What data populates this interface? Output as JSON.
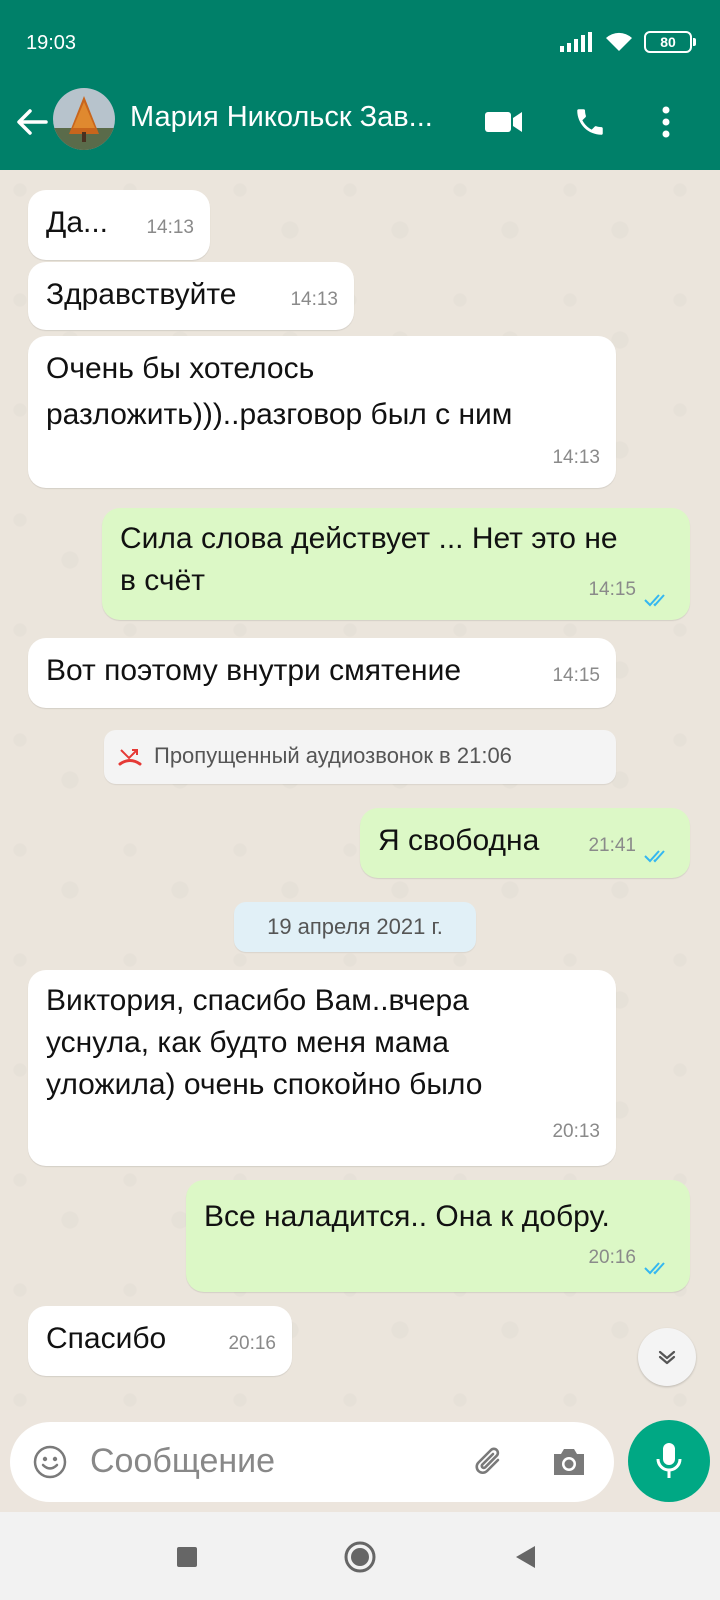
{
  "status_bar": {
    "time": "19:03",
    "battery": "80"
  },
  "header": {
    "contact_name": "Мария  Никольск Зав..."
  },
  "messages": [
    {
      "dir": "in",
      "text": "Да...",
      "time": "14:13"
    },
    {
      "dir": "in",
      "text": "Здравствуйте",
      "time": "14:13"
    },
    {
      "dir": "in",
      "lines": [
        "Очень бы хотелось",
        "разложить)))..разговор был с ним"
      ],
      "time": "14:13"
    },
    {
      "dir": "out",
      "lines": [
        "Сила слова действует ... Нет это не",
        "в счёт"
      ],
      "time": "14:15",
      "status": "read"
    },
    {
      "dir": "in",
      "text": "Вот поэтому внутри смятение",
      "time": "14:15"
    },
    {
      "dir": "system",
      "text": "Пропущенный аудиозвонок в 21:06"
    },
    {
      "dir": "out",
      "text": "Я свободна",
      "time": "21:41",
      "status": "read"
    },
    {
      "dir": "date",
      "text": "19 апреля 2021 г."
    },
    {
      "dir": "in",
      "lines": [
        "Виктория, спасибо Вам..вчера",
        "уснула, как будто меня мама",
        "уложила) очень спокойно было"
      ],
      "time": "20:13"
    },
    {
      "dir": "out",
      "text": "Все наладится.. Она к добру.",
      "time": "20:16",
      "status": "read"
    },
    {
      "dir": "in",
      "text": "Спасибо",
      "time": "20:16"
    }
  ],
  "composer": {
    "placeholder": "Сообщение"
  },
  "colors": {
    "header": "#008069",
    "outgoing": "#dcf8c6",
    "incoming": "#ffffff",
    "accent": "#00a884",
    "read_ticks": "#34b7f1",
    "missed_call": "#e53935"
  },
  "icons": [
    "back-arrow-icon",
    "video-call-icon",
    "phone-icon",
    "more-icon",
    "missed-call-icon",
    "double-check-icon",
    "chevron-down-icon",
    "emoji-icon",
    "attach-icon",
    "camera-icon",
    "mic-icon",
    "nav-recents-icon",
    "nav-home-icon",
    "nav-back-icon"
  ]
}
